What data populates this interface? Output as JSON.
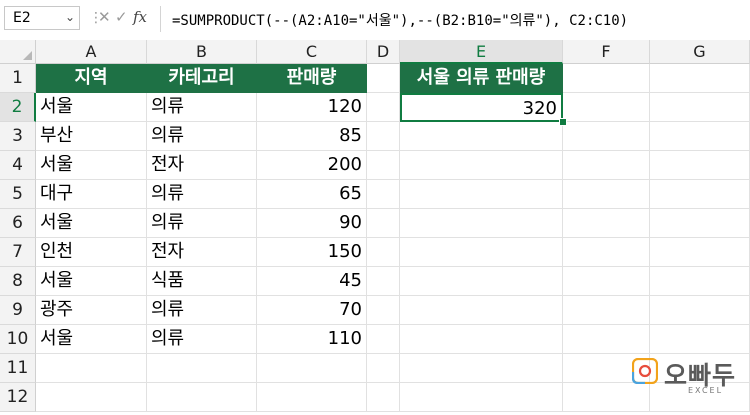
{
  "formula_bar": {
    "name_box": "E2",
    "fx_label": "fx",
    "formula": "=SUMPRODUCT(--(A2:A10=\"서울\"),--(B2:B10=\"의류\"), C2:C10)"
  },
  "columns": [
    "A",
    "B",
    "C",
    "D",
    "E",
    "F",
    "G"
  ],
  "rows": [
    "1",
    "2",
    "3",
    "4",
    "5",
    "6",
    "7",
    "8",
    "9",
    "10",
    "11",
    "12"
  ],
  "table": {
    "headers": [
      "지역",
      "카테고리",
      "판매량"
    ],
    "data": [
      [
        "서울",
        "의류",
        "120"
      ],
      [
        "부산",
        "의류",
        "85"
      ],
      [
        "서울",
        "전자",
        "200"
      ],
      [
        "대구",
        "의류",
        "65"
      ],
      [
        "서울",
        "의류",
        "90"
      ],
      [
        "인천",
        "전자",
        "150"
      ],
      [
        "서울",
        "식품",
        "45"
      ],
      [
        "광주",
        "의류",
        "70"
      ],
      [
        "서울",
        "의류",
        "110"
      ]
    ]
  },
  "result": {
    "header": "서울 의류 판매량",
    "value": "320"
  },
  "logo": {
    "text": "오빠두",
    "sub": "EXCEL"
  },
  "colors": {
    "accent": "#107c41",
    "header_fill": "#1e7145"
  }
}
